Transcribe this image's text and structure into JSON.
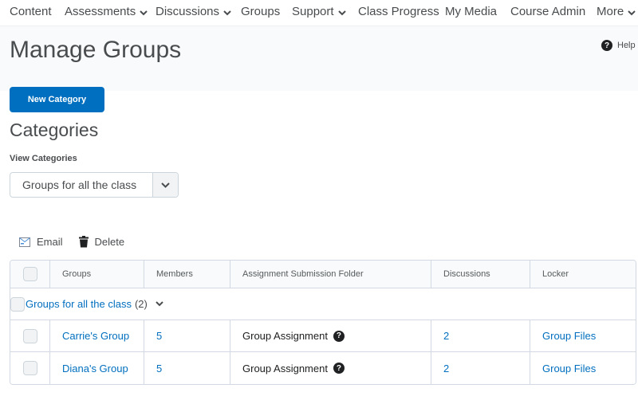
{
  "nav": {
    "items": [
      {
        "label": "Content",
        "has_menu": false
      },
      {
        "label": "Assessments",
        "has_menu": true
      },
      {
        "label": "Discussions",
        "has_menu": true
      },
      {
        "label": "Groups",
        "has_menu": false
      },
      {
        "label": "Support",
        "has_menu": true
      },
      {
        "label": "Class Progress",
        "has_menu": false
      },
      {
        "label": "My Media",
        "has_menu": false
      },
      {
        "label": "Course Admin",
        "has_menu": false
      },
      {
        "label": "More",
        "has_menu": true
      }
    ]
  },
  "header": {
    "title": "Manage Groups",
    "help_label": "Help"
  },
  "new_category_label": "New Category",
  "categories": {
    "title": "Categories",
    "view_label": "View Categories",
    "selected": "Groups for all the class"
  },
  "actions": {
    "email_label": "Email",
    "delete_label": "Delete"
  },
  "table": {
    "columns": [
      "Groups",
      "Members",
      "Assignment Submission Folder",
      "Discussions",
      "Locker"
    ],
    "category_row": {
      "name": "Groups for all the class",
      "count": "(2)"
    },
    "rows": [
      {
        "group": "Carrie's Group",
        "members": "5",
        "folder": "Group Assignment",
        "discussions": "2",
        "locker": "Group Files"
      },
      {
        "group": "Diana's Group",
        "members": "5",
        "folder": "Group Assignment",
        "discussions": "2",
        "locker": "Group Files"
      }
    ]
  },
  "colors": {
    "primary": "#006fbf",
    "link": "#006fbf",
    "text": "#494c4e"
  }
}
